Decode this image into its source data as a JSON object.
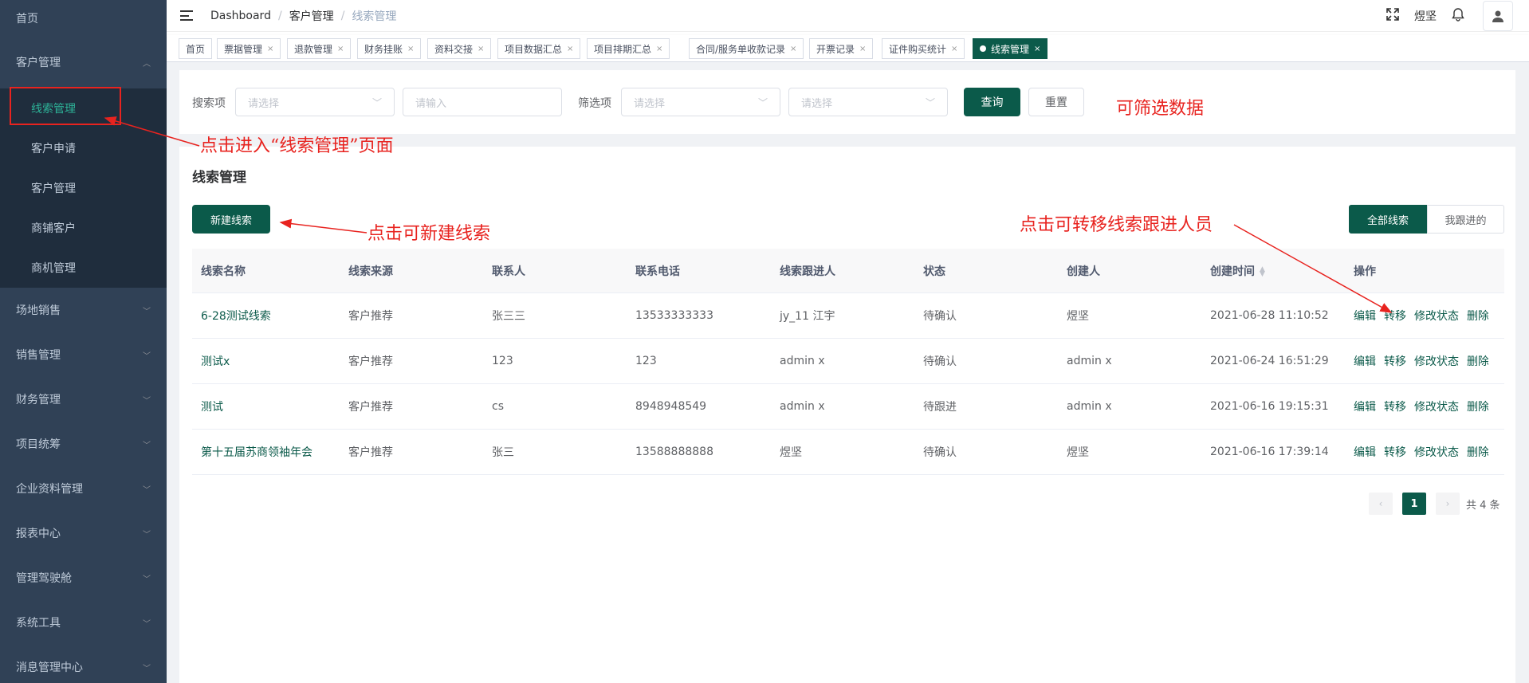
{
  "sidebar": {
    "home": "首页",
    "customer_group": "客户管理",
    "sub_items": [
      "线索管理",
      "客户申请",
      "客户管理",
      "商铺客户",
      "商机管理"
    ],
    "groups": [
      "场地销售",
      "销售管理",
      "财务管理",
      "项目统筹",
      "企业资料管理",
      "报表中心",
      "管理驾驶舱",
      "系统工具",
      "消息管理中心"
    ]
  },
  "breadcrumb": [
    "Dashboard",
    "客户管理",
    "线索管理"
  ],
  "header": {
    "user": "煜坚"
  },
  "tags": [
    "首页",
    "票据管理",
    "退款管理",
    "财务挂账",
    "资料交接",
    "项目数据汇总",
    "项目排期汇总",
    "合同/服务单收款记录",
    "开票记录",
    "证件购买统计",
    "线索管理"
  ],
  "search": {
    "search_label": "搜索项",
    "select_placeholder": "请选择",
    "input_placeholder": "请输入",
    "filter_label": "筛选项",
    "filter_placeholder_1": "请选择",
    "filter_placeholder_2": "请选择",
    "query_button": "查询",
    "reset_button": "重置"
  },
  "panel": {
    "title": "线索管理",
    "new_button": "新建线索",
    "toggle_all": "全部线索",
    "toggle_mine": "我跟进的"
  },
  "table": {
    "headers": [
      "线索名称",
      "线索来源",
      "联系人",
      "联系电话",
      "线索跟进人",
      "状态",
      "创建人",
      "创建时间",
      "操作"
    ],
    "rows": [
      [
        "6-28测试线索",
        "客户推荐",
        "张三三",
        "13533333333",
        "jy_11 江宇",
        "待确认",
        "煜坚",
        "2021-06-28 11:10:52"
      ],
      [
        "测试x",
        "客户推荐",
        "123",
        "123",
        "admin x",
        "待确认",
        "admin x",
        "2021-06-24 16:51:29"
      ],
      [
        "测试",
        "客户推荐",
        "cs",
        "8948948549",
        "admin x",
        "待跟进",
        "admin x",
        "2021-06-16 19:15:31"
      ],
      [
        "第十五届苏商领袖年会",
        "客户推荐",
        "张三",
        "13588888888",
        "煜坚",
        "待确认",
        "煜坚",
        "2021-06-16 17:39:14"
      ]
    ],
    "actions": [
      "编辑",
      "转移",
      "修改状态",
      "删除"
    ]
  },
  "pagination": {
    "current": "1",
    "total": "共 4 条"
  },
  "annotations": {
    "enter_page": "点击进入“线索管理”页面",
    "filter_data": "可筛选数据",
    "new_lead": "点击可新建线索",
    "transfer": "点击可转移线索跟进人员"
  },
  "colors": {
    "sidebar_bg": "#304156",
    "primary": "#0b5a4a",
    "annotation": "#e8231f"
  }
}
